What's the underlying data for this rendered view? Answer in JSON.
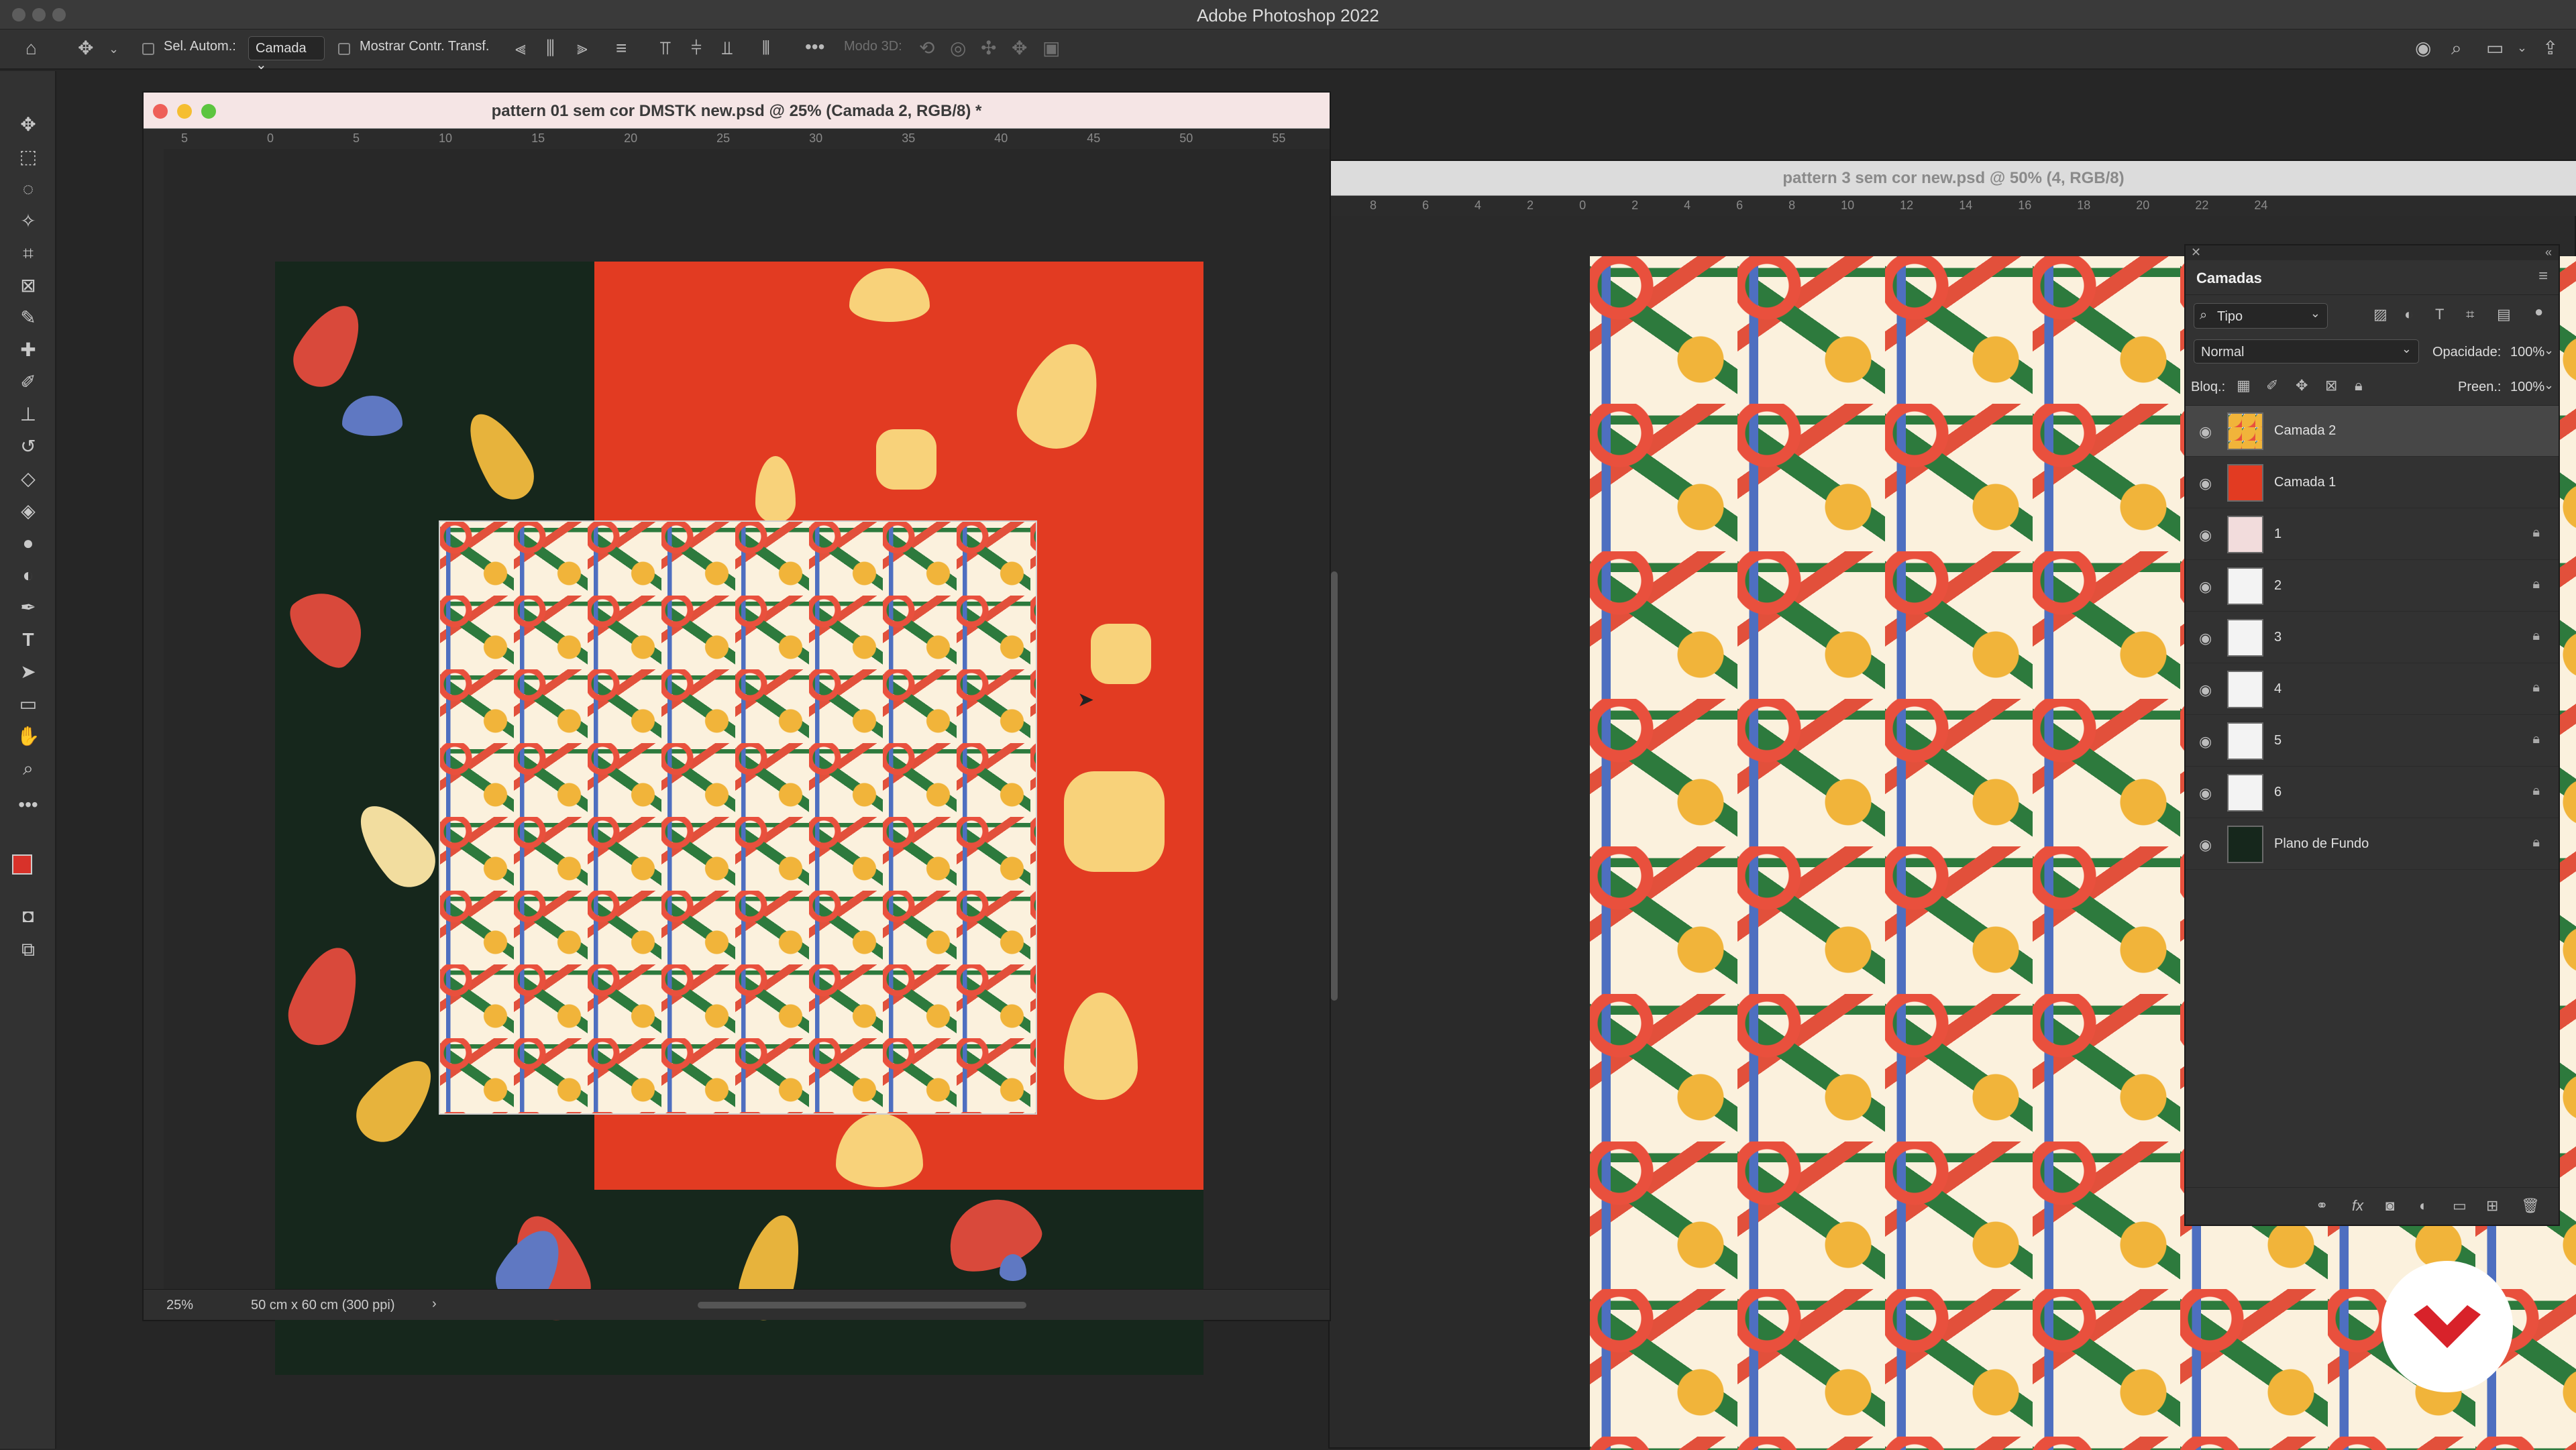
{
  "app_title": "Adobe Photoshop 2022",
  "options_bar": {
    "auto_select_label": "Sel. Autom.:",
    "auto_select_value": "Camada",
    "show_transform_label": "Mostrar Contr. Transf.",
    "mode_3d_label": "Modo 3D:"
  },
  "doc1": {
    "title": "pattern 01 sem cor DMSTK new.psd @ 25% (Camada 2, RGB/8) *",
    "zoom": "25%",
    "doc_size": "50 cm x 60 cm (300 ppi)",
    "ruler_ticks": [
      "5",
      "0",
      "5",
      "10",
      "15",
      "20",
      "25",
      "30",
      "35",
      "40",
      "45",
      "50",
      "55"
    ]
  },
  "doc2": {
    "title": "pattern 3 sem cor new.psd @ 50% (4, RGB/8)",
    "ruler_ticks": [
      "8",
      "6",
      "4",
      "2",
      "0",
      "2",
      "4",
      "6",
      "8",
      "10",
      "12",
      "14",
      "16",
      "18",
      "20",
      "22",
      "24"
    ]
  },
  "layers_panel": {
    "title": "Camadas",
    "filter_value": "Tipo",
    "blend_mode": "Normal",
    "opacity_label": "Opacidade:",
    "opacity_value": "100%",
    "lock_label": "Bloq.:",
    "fill_label": "Preen.:",
    "fill_value": "100%",
    "layers": [
      {
        "name": "Camada 2",
        "selected": true,
        "locked": false
      },
      {
        "name": "Camada 1",
        "selected": false,
        "locked": false
      },
      {
        "name": "1",
        "selected": false,
        "locked": true
      },
      {
        "name": "2",
        "selected": false,
        "locked": true
      },
      {
        "name": "3",
        "selected": false,
        "locked": true
      },
      {
        "name": "4",
        "selected": false,
        "locked": true
      },
      {
        "name": "5",
        "selected": false,
        "locked": true
      },
      {
        "name": "6",
        "selected": false,
        "locked": true
      },
      {
        "name": "Plano de Fundo",
        "selected": false,
        "locked": true
      }
    ]
  },
  "colors": {
    "foreground": "#d8322a",
    "background": "#ffffff",
    "brand_badge": "#d8222a"
  }
}
